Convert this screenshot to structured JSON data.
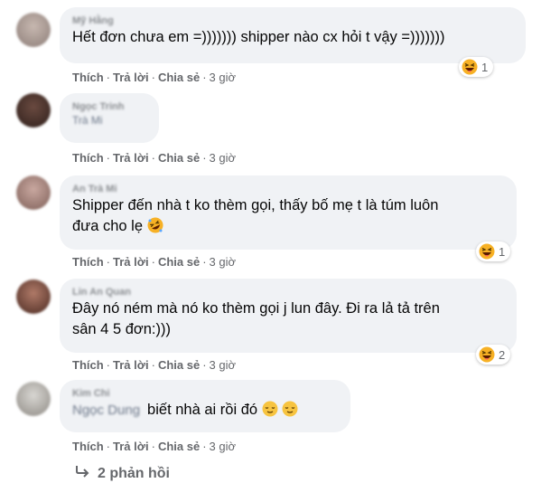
{
  "comments": [
    {
      "author": "Mỹ Hằng",
      "text": "Hết đơn chưa em =))))))) shipper nào cx hỏi t vậy =)))))))",
      "reaction_count": "1",
      "actions": {
        "like": "Thích",
        "reply": "Trả lời",
        "share": "Chia sẻ",
        "time": "3 giờ"
      }
    },
    {
      "author": "Ngọc Trinh",
      "text": "Trà Mi",
      "actions": {
        "like": "Thích",
        "reply": "Trả lời",
        "share": "Chia sẻ",
        "time": "3 giờ"
      }
    },
    {
      "author": "An Trà Mi",
      "text": "Shipper đến nhà t ko thèm gọi, thấy bố mẹ t là túm luôn\nđưa cho lẹ",
      "reaction_count": "1",
      "actions": {
        "like": "Thích",
        "reply": "Trả lời",
        "share": "Chia sẻ",
        "time": "3 giờ"
      }
    },
    {
      "author": "Lin An Quan",
      "text": "Đây nó ném mà nó ko thèm gọi j lun đây. Đi ra lả tả trên\nsân 4 5 đơn:)))",
      "reaction_count": "2",
      "actions": {
        "like": "Thích",
        "reply": "Trả lời",
        "share": "Chia sẻ",
        "time": "3 giờ"
      }
    },
    {
      "author": "Kim Chi",
      "tagged_name": "Ngọc Dung",
      "text": "biết nhà ai rồi đó",
      "actions": {
        "like": "Thích",
        "reply": "Trả lời",
        "share": "Chia sẻ",
        "time": "3 giờ"
      }
    }
  ],
  "replies_label": "2 phản hồi",
  "colors": {
    "bubble": "#f0f2f5",
    "meta": "#65676b",
    "haha": "#f7b125"
  }
}
